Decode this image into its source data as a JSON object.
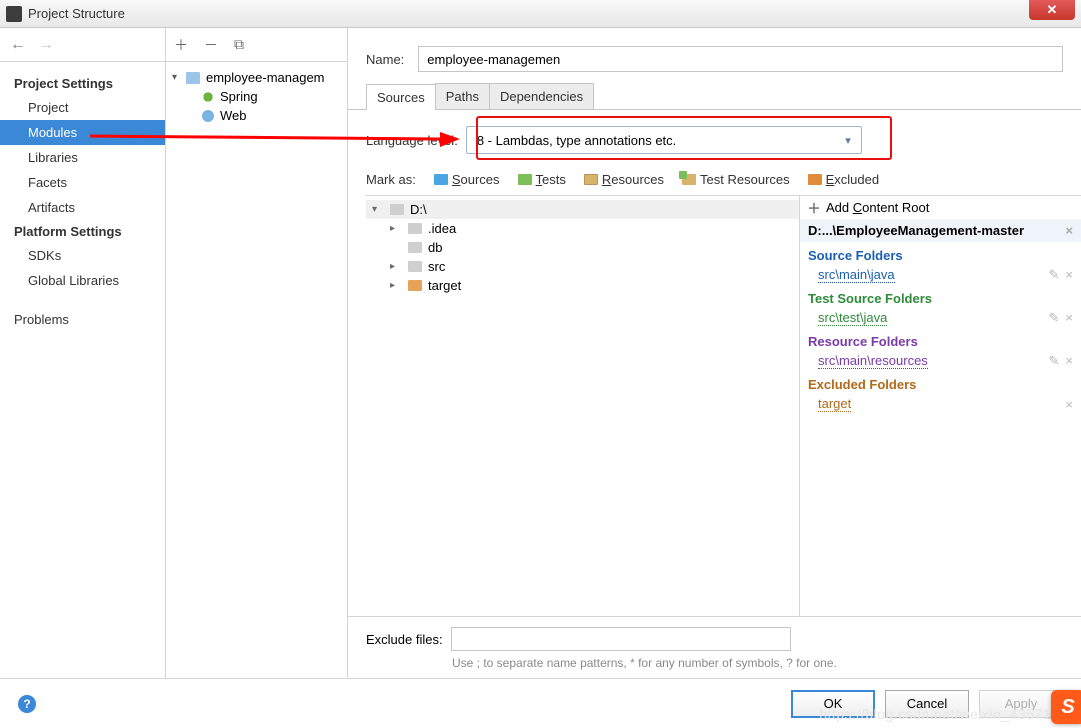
{
  "window": {
    "title": "Project Structure"
  },
  "nav": {
    "section1": "Project Settings",
    "items1": [
      "Project",
      "Modules",
      "Libraries",
      "Facets",
      "Artifacts"
    ],
    "selected1": "Modules",
    "section2": "Platform Settings",
    "items2": [
      "SDKs",
      "Global Libraries"
    ],
    "section3": "",
    "items3": [
      "Problems"
    ]
  },
  "modules": {
    "root": "employee-managem",
    "children": [
      "Spring",
      "Web"
    ]
  },
  "form": {
    "name_label": "Name:",
    "name_value": "employee-managemen",
    "tabs": [
      "Sources",
      "Paths",
      "Dependencies"
    ],
    "active_tab": "Sources",
    "lang_label": "Language level:",
    "lang_value": "8 - Lambdas, type annotations etc.",
    "mark_label": "Mark as:",
    "mark_items": [
      {
        "label": "Sources",
        "u": "S"
      },
      {
        "label": "Tests",
        "u": "T"
      },
      {
        "label": "Resources",
        "u": "R"
      },
      {
        "label": "Test Resources",
        "u": ""
      },
      {
        "label": "Excluded",
        "u": "E"
      }
    ],
    "tree_root": "D:\\",
    "tree": [
      {
        "name": ".idea",
        "expandable": true
      },
      {
        "name": "db",
        "expandable": false
      },
      {
        "name": "src",
        "expandable": true
      },
      {
        "name": "target",
        "expandable": true,
        "orange": true
      }
    ],
    "content_root": {
      "add_label": "Add Content Root",
      "path": "D:...\\EmployeeManagement-master",
      "groups": [
        {
          "title": "Source Folders",
          "cls": "srcf",
          "items": [
            "src\\main\\java"
          ]
        },
        {
          "title": "Test Source Folders",
          "cls": "tstf",
          "items": [
            "src\\test\\java"
          ]
        },
        {
          "title": "Resource Folders",
          "cls": "resf",
          "items": [
            "src\\main\\resources"
          ]
        },
        {
          "title": "Excluded Folders",
          "cls": "excf",
          "items": [
            "target"
          ]
        }
      ]
    },
    "exclude_label": "Exclude files:",
    "exclude_hint": "Use ; to separate name patterns, * for any number of symbols, ? for one."
  },
  "footer": {
    "ok": "OK",
    "cancel": "Cancel",
    "apply": "Apply"
  },
  "watermark": "https://blog.csdn.net/weixin_43571"
}
